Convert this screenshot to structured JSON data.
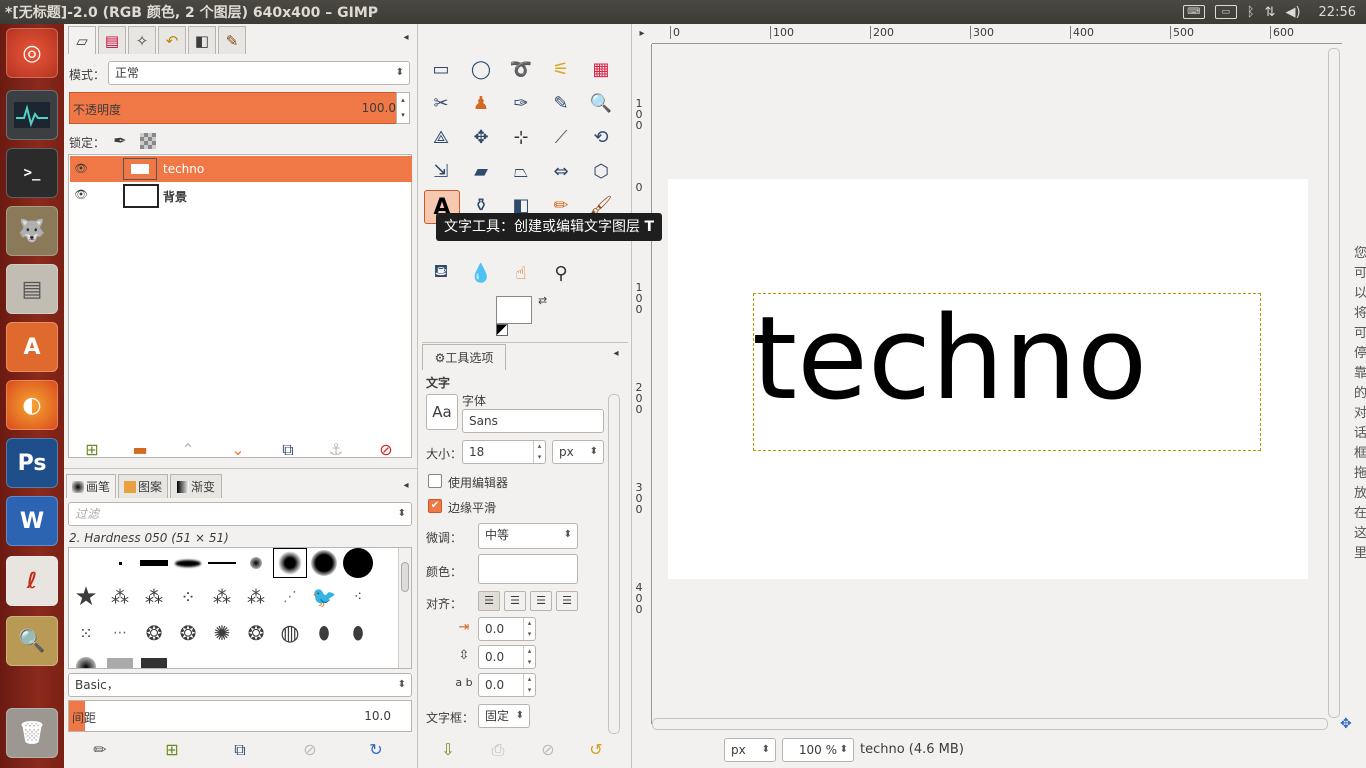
{
  "window": {
    "title": "*[无标题]-2.0 (RGB 颜色, 2 个图层) 640x400 – GIMP"
  },
  "tray": {
    "keyboard": "⌨",
    "battery": "▭",
    "bluetooth": "ᛒ",
    "network": "⇅",
    "volume": "🔊",
    "clock": "22:56"
  },
  "launcher": {
    "items": [
      "ubuntu-icon",
      "system-monitor-icon",
      "terminal-icon",
      "gimp-icon",
      "file-manager-icon",
      "software-center-icon",
      "firefox-icon",
      "photoshop-icon",
      "writer-icon",
      "reader-icon",
      "image-viewer-icon",
      "trash-icon"
    ],
    "ps_label": "Ps",
    "w_label": "W",
    "a_label": "A"
  },
  "layers": {
    "mode_label": "模式：",
    "mode_value": "正常",
    "opacity_label": "不透明度",
    "opacity_value": "100.0",
    "lock_label": "锁定：",
    "rows": [
      {
        "name": "techno",
        "selected": true
      },
      {
        "name": "背景",
        "selected": false
      }
    ]
  },
  "brushes": {
    "tabs": [
      "画笔",
      "图案",
      "渐变"
    ],
    "filter_placeholder": "过滤",
    "current_brush": "2. Hardness 050 (51 × 51)",
    "tag_value": "Basic，",
    "spacing_label": "间距",
    "spacing_value": "10.0"
  },
  "tooltip": {
    "text": "文字工具：创建或编辑文字图层",
    "shortcut": "T"
  },
  "tool_options": {
    "tab_label": "工具选项",
    "section": "文字",
    "font_label": "字体",
    "font_value": "Sans",
    "font_preview": "Aa",
    "size_label": "大小：",
    "size_value": "18",
    "size_unit": "px",
    "use_editor_label": "使用编辑器",
    "use_editor": false,
    "antialias_label": "边缘平滑",
    "antialias": true,
    "hinting_label": "微调：",
    "hinting_value": "中等",
    "color_label": "颜色：",
    "justify_label": "对齐：",
    "indent_value": "0.0",
    "line_spacing_value": "0.0",
    "letter_spacing_value": "0.0",
    "box_label": "文字框：",
    "box_value": "固定"
  },
  "canvas": {
    "text": "techno",
    "ruler_h": [
      "0",
      "100",
      "200",
      "300",
      "400",
      "500",
      "600"
    ],
    "ruler_v": [
      "100",
      "0",
      "100",
      "200",
      "300",
      "400"
    ],
    "side_text": "您可以将可停靠的对话框拖放在这里"
  },
  "statusbar": {
    "unit": "px",
    "zoom": "100 %",
    "info": "techno (4.6 MB)"
  },
  "colors": {
    "accent": "#f07746",
    "launcher": "#7a2014",
    "topbar": "#3c3b37"
  }
}
